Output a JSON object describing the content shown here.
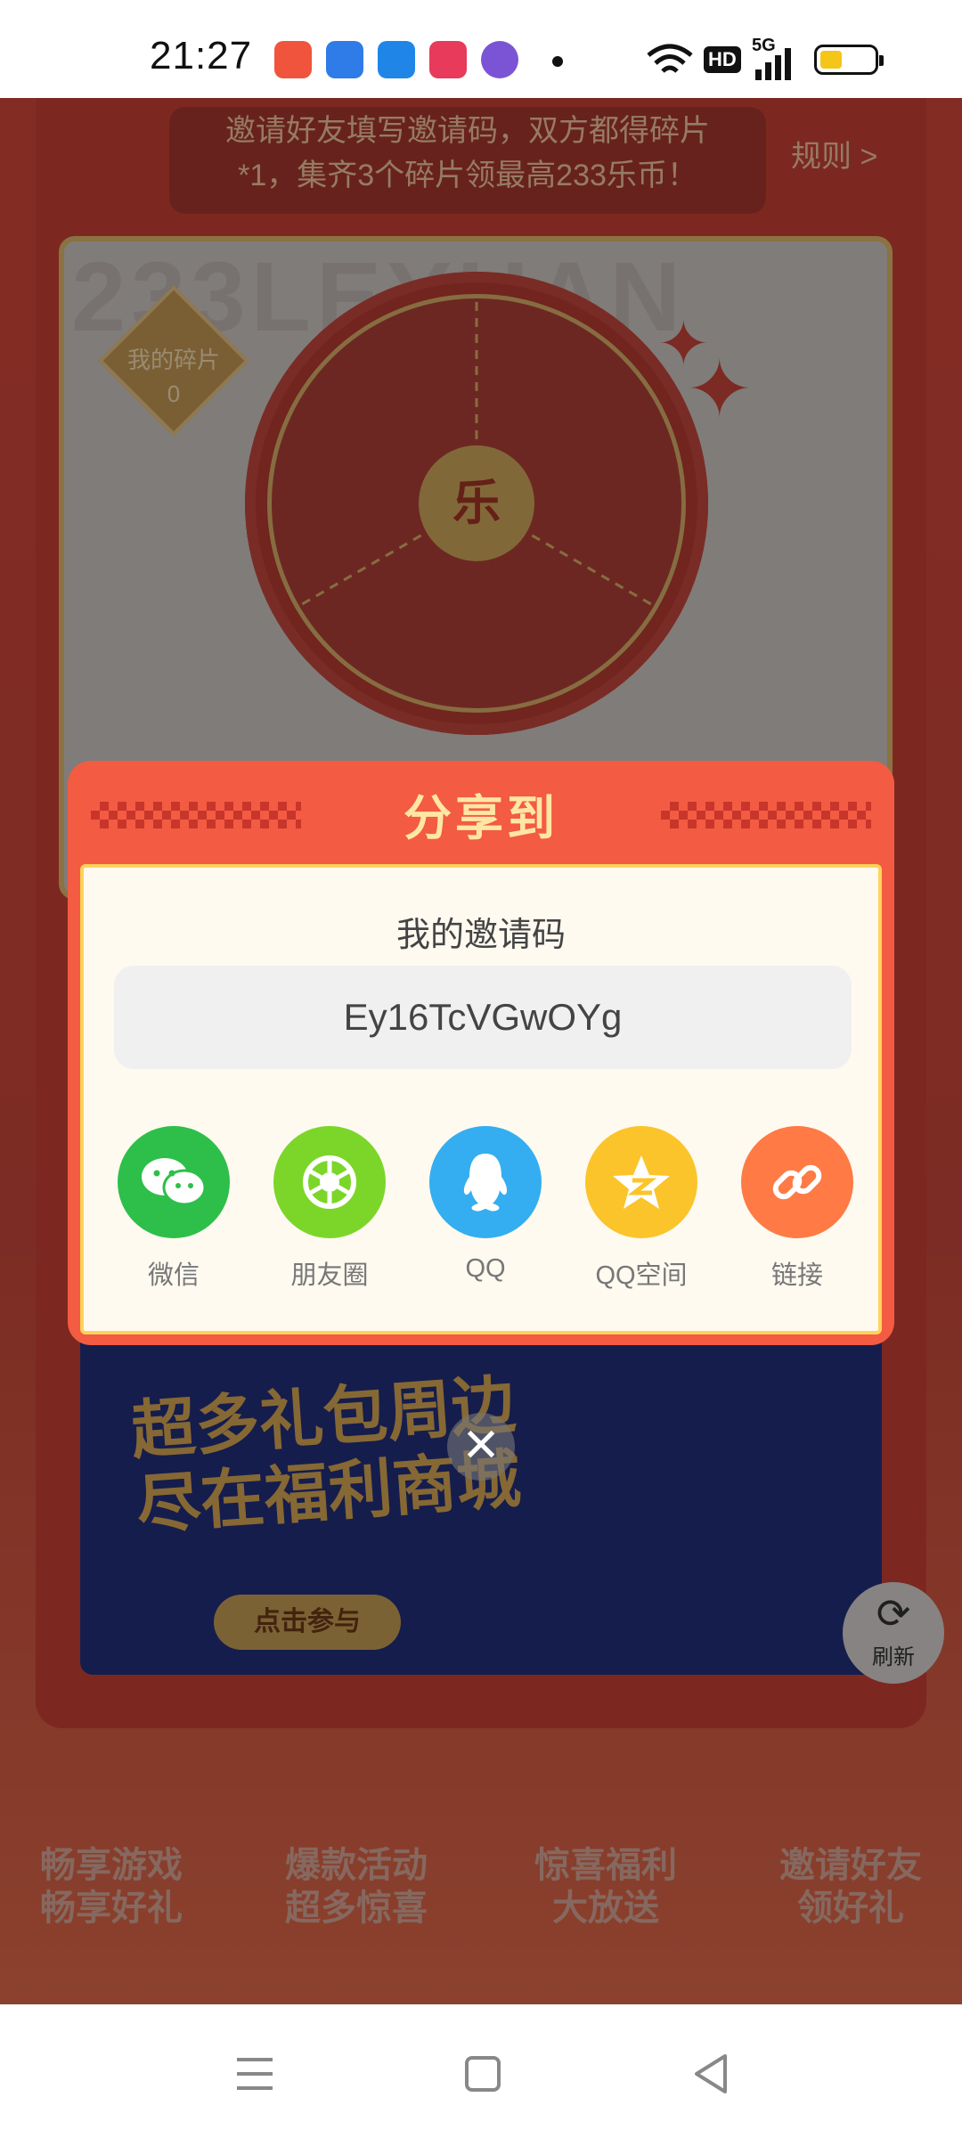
{
  "status_bar": {
    "time": "21:27",
    "hd_label": "HD",
    "network_label": "5G",
    "apps": [
      {
        "name": "music-app-icon",
        "color": "#f0543c"
      },
      {
        "name": "blue-app-icon",
        "color": "#2f7be8"
      },
      {
        "name": "browser-app-icon",
        "color": "#1f86e8"
      },
      {
        "name": "video-app-icon",
        "color": "#e83a5a"
      },
      {
        "name": "game-app-icon",
        "color": "#7b54d6"
      }
    ]
  },
  "background": {
    "notice": "邀请好友填写邀请码，双方都得碎片\n*1，集齐3个碎片领最高233乐币！",
    "rules_link": "规则 >",
    "watermark": "233LEYUAN",
    "my_fragments_label": "我的碎片",
    "my_fragments_count": "0",
    "wheel_center": "乐",
    "promo_title": "超多礼包周边\n尽在福利商城",
    "promo_button": "点击参与",
    "refresh_label": "刷新",
    "features": [
      "畅享游戏\n畅享好礼",
      "爆款活动\n超多惊喜",
      "惊喜福利\n大放送",
      "邀请好友\n领好礼"
    ]
  },
  "modal": {
    "title": "分享到",
    "code_label": "我的邀请码",
    "invite_code": "Ey16TcVGwOYg",
    "share_targets": [
      {
        "label": "微信",
        "icon": "wechat-icon",
        "color": "#2dbf4a"
      },
      {
        "label": "朋友圈",
        "icon": "moments-icon",
        "color": "#7bd629"
      },
      {
        "label": "QQ",
        "icon": "qq-icon",
        "color": "#34aef0"
      },
      {
        "label": "QQ空间",
        "icon": "qzone-icon",
        "color": "#fbc42a"
      },
      {
        "label": "链接",
        "icon": "link-icon",
        "color": "#ff7a45"
      }
    ],
    "close_icon": "close-icon"
  },
  "nav_bar": {
    "buttons": [
      "menu-icon",
      "home-icon",
      "back-icon"
    ]
  },
  "colors": {
    "modal_red": "#f35b43",
    "modal_title": "#ffe6a6",
    "body_bg": "#fffaf0",
    "border_gold": "#ffd25a"
  }
}
